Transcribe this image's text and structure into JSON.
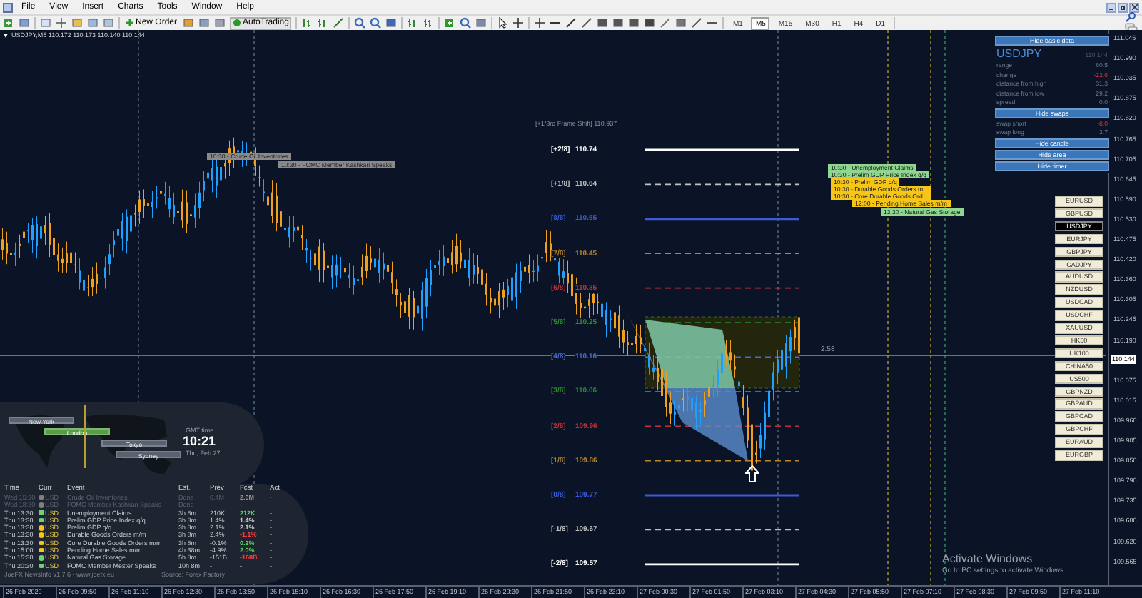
{
  "menu": [
    "File",
    "View",
    "Insert",
    "Charts",
    "Tools",
    "Window",
    "Help"
  ],
  "toolbar": {
    "new_order": "New Order",
    "auto_trading": "AutoTrading"
  },
  "timeframes": [
    {
      "label": "M1",
      "selected": false
    },
    {
      "label": "M5",
      "selected": true
    },
    {
      "label": "M15",
      "selected": false
    },
    {
      "label": "M30",
      "selected": false
    },
    {
      "label": "H1",
      "selected": false
    },
    {
      "label": "H4",
      "selected": false
    },
    {
      "label": "D1",
      "selected": false
    }
  ],
  "chart_header": "USDJPY,M5  110.172 110.173 110.140 110.144",
  "frame_shift": "[+1/3rd Frame Shift]  110.937",
  "murrey_levels": [
    {
      "label": "[+2/8]",
      "price": "110.74",
      "color": "#ffffff",
      "kind": "solid"
    },
    {
      "label": "[+1/8]",
      "price": "110.64",
      "color": "#bfbfbf",
      "kind": "dashed"
    },
    {
      "label": "[8/8]",
      "price": "110.55",
      "color": "#3b5bd6",
      "kind": "solid"
    },
    {
      "label": "[7/8]",
      "price": "110.45",
      "color": "#b8862e",
      "kind": "dashed"
    },
    {
      "label": "[6/8]",
      "price": "110.35",
      "color": "#c0303a",
      "kind": "dashed"
    },
    {
      "label": "[5/8]",
      "price": "110.25",
      "color": "#2e8b2e",
      "kind": "dashed"
    },
    {
      "label": "[4/8]",
      "price": "110.16",
      "color": "#4a6bd6",
      "kind": "dashed"
    },
    {
      "label": "[3/8]",
      "price": "110.06",
      "color": "#2e8b2e",
      "kind": "dashed"
    },
    {
      "label": "[2/8]",
      "price": "109.96",
      "color": "#c0303a",
      "kind": "dashed"
    },
    {
      "label": "[1/8]",
      "price": "109.86",
      "color": "#b8862e",
      "kind": "dashed"
    },
    {
      "label": "[0/8]",
      "price": "109.77",
      "color": "#3b5bd6",
      "kind": "solid"
    },
    {
      "label": "[-1/8]",
      "price": "109.67",
      "color": "#bfbfbf",
      "kind": "dashed"
    },
    {
      "label": "[-2/8]",
      "price": "109.57",
      "color": "#ffffff",
      "kind": "solid"
    }
  ],
  "timer": "2:58",
  "price_axis": [
    {
      "text": "111.045",
      "kind": "tick"
    },
    {
      "text": "110.990",
      "kind": "tick"
    },
    {
      "text": "110.935",
      "kind": "tick"
    },
    {
      "text": "110.875",
      "kind": "tick"
    },
    {
      "text": "110.820",
      "kind": "tick"
    },
    {
      "text": "110.765",
      "kind": "tick"
    },
    {
      "text": "110.705",
      "kind": "tick"
    },
    {
      "text": "110.645",
      "kind": "tick"
    },
    {
      "text": "110.590",
      "kind": "tick"
    },
    {
      "text": "110.530",
      "kind": "tick"
    },
    {
      "text": "110.475",
      "kind": "tick"
    },
    {
      "text": "110.420",
      "kind": "tick"
    },
    {
      "text": "110.360",
      "kind": "tick"
    },
    {
      "text": "110.305",
      "kind": "tick"
    },
    {
      "text": "110.245",
      "kind": "tick"
    },
    {
      "text": "110.190",
      "kind": "tick"
    },
    {
      "text": "110.144",
      "kind": "current"
    },
    {
      "text": "110.075",
      "kind": "tick"
    },
    {
      "text": "110.015",
      "kind": "tick"
    },
    {
      "text": "109.960",
      "kind": "tick"
    },
    {
      "text": "109.905",
      "kind": "tick"
    },
    {
      "text": "109.850",
      "kind": "tick"
    },
    {
      "text": "109.790",
      "kind": "tick"
    },
    {
      "text": "109.735",
      "kind": "tick"
    },
    {
      "text": "109.680",
      "kind": "tick"
    },
    {
      "text": "109.620",
      "kind": "tick"
    },
    {
      "text": "109.565",
      "kind": "tick"
    }
  ],
  "time_axis": [
    "26 Feb 2020",
    "26 Feb 09:50",
    "26 Feb 11:10",
    "26 Feb 12:30",
    "26 Feb 13:50",
    "26 Feb 15:10",
    "26 Feb 16:30",
    "26 Feb 17:50",
    "26 Feb 19:10",
    "26 Feb 20:30",
    "26 Feb 21:50",
    "26 Feb 23:10",
    "27 Feb 00:30",
    "27 Feb 01:50",
    "27 Feb 03:10",
    "27 Feb 04:30",
    "27 Feb 05:50",
    "27 Feb 07:10",
    "27 Feb 08:30",
    "27 Feb 09:50",
    "27 Feb 11:10"
  ],
  "info_panel": {
    "hide_basic": "Hide basic data",
    "symbol": "USDJPY",
    "price": "110.144",
    "stats": [
      {
        "label": "range",
        "value": "60.5",
        "negative": false
      },
      {
        "label": "change",
        "value": "-23.6",
        "negative": true
      },
      {
        "label": "distance from high",
        "value": "31.3",
        "negative": false
      },
      {
        "label": "distance from low",
        "value": "29.2",
        "negative": false
      },
      {
        "label": "spread",
        "value": "0.0",
        "negative": false
      }
    ],
    "hide_swaps": "Hide swaps",
    "swaps": [
      {
        "label": "swap short",
        "value": "-8.0",
        "negative": true
      },
      {
        "label": "swap long",
        "value": "3.7",
        "negative": false
      }
    ],
    "buttons": [
      "Hide candle",
      "Hide area",
      "Hide timer"
    ]
  },
  "symbols": [
    {
      "label": "EURUSD",
      "selected": false
    },
    {
      "label": "GBPUSD",
      "selected": false
    },
    {
      "label": "USDJPY",
      "selected": true
    },
    {
      "label": "EURJPY",
      "selected": false
    },
    {
      "label": "GBPJPY",
      "selected": false
    },
    {
      "label": "CADJPY",
      "selected": false
    },
    {
      "label": "AUDUSD",
      "selected": false
    },
    {
      "label": "NZDUSD",
      "selected": false
    },
    {
      "label": "USDCAD",
      "selected": false
    },
    {
      "label": "USDCHF",
      "selected": false
    },
    {
      "label": "XAUUSD",
      "selected": false
    },
    {
      "label": "HK50",
      "selected": false
    },
    {
      "label": "UK100",
      "selected": false
    },
    {
      "label": "CHINA50",
      "selected": false
    },
    {
      "label": "US500",
      "selected": false
    },
    {
      "label": "GBPNZD",
      "selected": false
    },
    {
      "label": "GBPAUD",
      "selected": false
    },
    {
      "label": "GBPCAD",
      "selected": false
    },
    {
      "label": "GBPCHF",
      "selected": false
    },
    {
      "label": "EURAUD",
      "selected": false
    },
    {
      "label": "EURGBP",
      "selected": false
    }
  ],
  "chart_news": [
    {
      "text": "10:30 - Crude Oil Inventories",
      "color": "#8a8a8a"
    },
    {
      "text": "10:30 - FOMC Member Kashkari Speaks",
      "color": "#8a8a8a"
    },
    {
      "text": "10:30 - Unemployment Claims",
      "color": "#8fd68f"
    },
    {
      "text": "10:30 - Prelim GDP Price Index q/q",
      "color": "#8fd68f"
    },
    {
      "text": "10:30 - Prelim GDP q/q",
      "color": "#f5c518"
    },
    {
      "text": "10:30 - Durable Goods Orders m...",
      "color": "#f5c518"
    },
    {
      "text": "10:30 - Core Durable Goods Ord...",
      "color": "#f5c518"
    },
    {
      "text": "12:00 - Pending Home Sales m/m",
      "color": "#f5c518"
    },
    {
      "text": "13:30 - Natural Gas Storage",
      "color": "#8fd68f"
    }
  ],
  "sessions": {
    "cities": [
      {
        "name": "New York",
        "open": false
      },
      {
        "name": "London",
        "open": true
      },
      {
        "name": "Tokyo",
        "open": false
      },
      {
        "name": "Sydney",
        "open": false
      }
    ],
    "clock_label": "GMT time",
    "clock": "10:21",
    "date": "Thu, Feb 27"
  },
  "news_table": {
    "columns": [
      "Time",
      "Curr",
      "Event",
      "Est.",
      "Prev",
      "Fcst",
      "Act"
    ],
    "rows": [
      {
        "time": "Wed 15:30",
        "currency": "USD",
        "color": "#808080",
        "event": "Crude Oil Inventories",
        "est": "Done",
        "prev": "0.4M",
        "fcst": {
          "text": "2.0M",
          "color": "#9a9a9a"
        },
        "act": "-",
        "past": true
      },
      {
        "time": "Wed 18:30",
        "currency": "USD",
        "color": "#808080",
        "event": "FOMC Member Kashkari Speaks",
        "est": "Done",
        "prev": "-",
        "fcst": {
          "text": "-"
        },
        "act": "-",
        "past": true
      },
      {
        "time": "Thu 13:30",
        "currency": "USD",
        "color": "#6fd36f",
        "event": "Unemployment Claims",
        "est": "3h 8m",
        "prev": "210K",
        "fcst": {
          "text": "212K",
          "color": "#5fd35f"
        },
        "act": "-",
        "past": false
      },
      {
        "time": "Thu 13:30",
        "currency": "USD",
        "color": "#6fd36f",
        "event": "Prelim GDP Price Index q/q",
        "est": "3h 8m",
        "prev": "1.4%",
        "fcst": {
          "text": "1.4%",
          "color": "#d0d0d0"
        },
        "act": "-",
        "past": false
      },
      {
        "time": "Thu 13:30",
        "currency": "USD",
        "color": "#f5c518",
        "event": "Prelim GDP q/q",
        "est": "3h 8m",
        "prev": "2.1%",
        "fcst": {
          "text": "2.1%",
          "color": "#d0d0d0"
        },
        "act": "-",
        "past": false
      },
      {
        "time": "Thu 13:30",
        "currency": "USD",
        "color": "#f5c518",
        "event": "Durable Goods Orders m/m",
        "est": "3h 8m",
        "prev": "2.4%",
        "fcst": {
          "text": "-1.1%",
          "color": "#ff4040"
        },
        "act": "-",
        "past": false
      },
      {
        "time": "Thu 13:30",
        "currency": "USD",
        "color": "#f5c518",
        "event": "Core Durable Goods Orders m/m",
        "est": "3h 8m",
        "prev": "-0.1%",
        "fcst": {
          "text": "0.2%",
          "color": "#5fd35f"
        },
        "act": "-",
        "past": false
      },
      {
        "time": "Thu 15:00",
        "currency": "USD",
        "color": "#f5c518",
        "event": "Pending Home Sales m/m",
        "est": "4h 38m",
        "prev": "-4.9%",
        "fcst": {
          "text": "2.0%",
          "color": "#5fd35f"
        },
        "act": "-",
        "past": false
      },
      {
        "time": "Thu 15:30",
        "currency": "USD",
        "color": "#6fd36f",
        "event": "Natural Gas Storage",
        "est": "5h 8m",
        "prev": "-151B",
        "fcst": {
          "text": "-168B",
          "color": "#ff4040"
        },
        "act": "-",
        "past": false
      },
      {
        "time": "Thu 20:30",
        "currency": "USD",
        "color": "#6fd36f",
        "event": "FOMC Member Mester Speaks",
        "est": "10h 8m",
        "prev": "-",
        "fcst": {
          "text": "-"
        },
        "act": "-",
        "past": false
      }
    ],
    "footer": "JoeFX NewsInfo v1.7.6  -  www.joefx.eu",
    "source": "Source: Forex Factory"
  },
  "activation": {
    "title": "Activate Windows",
    "text": "Go to PC settings to activate Windows."
  }
}
